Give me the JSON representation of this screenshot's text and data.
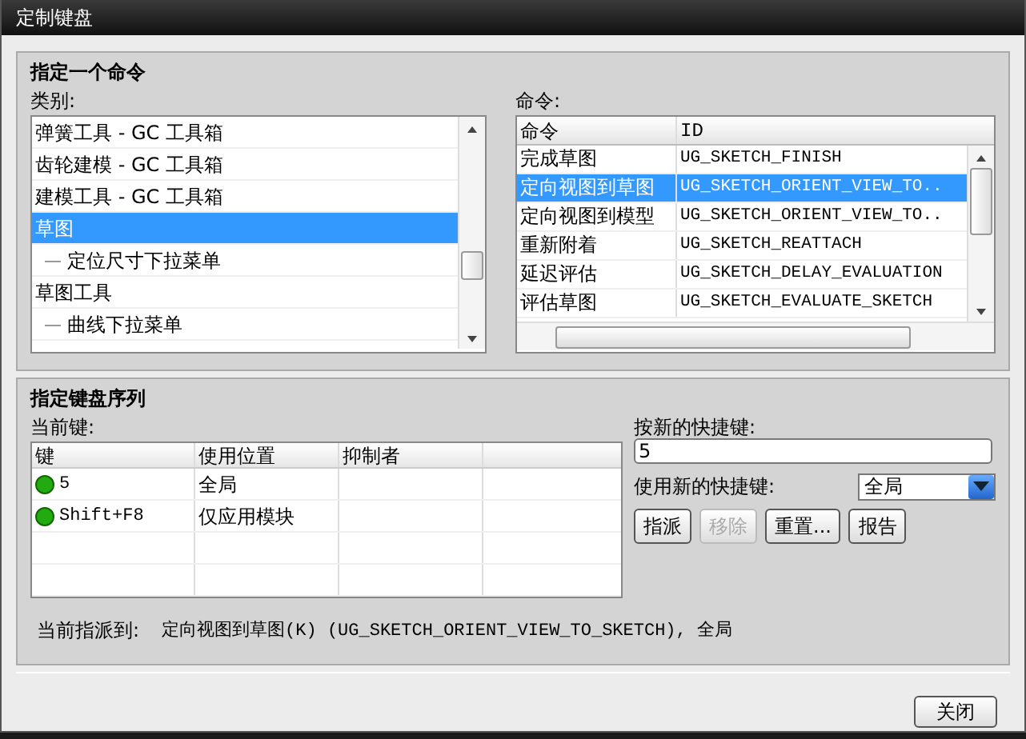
{
  "window": {
    "title": "定制键盘"
  },
  "command_section": {
    "title": "指定一个命令",
    "category_label": "类别:",
    "categories": [
      {
        "label": "弹簧工具 - GC 工具箱",
        "selected": false
      },
      {
        "label": "齿轮建模 - GC 工具箱",
        "selected": false
      },
      {
        "label": "建模工具 - GC 工具箱",
        "selected": false
      },
      {
        "label": "草图",
        "selected": true,
        "children": [
          {
            "label": "定位尺寸下拉菜单",
            "selected": false
          }
        ]
      },
      {
        "label": "草图工具",
        "selected": false,
        "children": [
          {
            "label": "曲线下拉菜单",
            "selected": false
          }
        ]
      }
    ],
    "command_label": "命令:",
    "command_columns": [
      "命令",
      "ID"
    ],
    "commands": [
      {
        "name": "完成草图",
        "id": "UG_SKETCH_FINISH",
        "selected": false
      },
      {
        "name": "定向视图到草图",
        "id": "UG_SKETCH_ORIENT_VIEW_TO..",
        "selected": true
      },
      {
        "name": "定向视图到模型",
        "id": "UG_SKETCH_ORIENT_VIEW_TO..",
        "selected": false
      },
      {
        "name": "重新附着",
        "id": "UG_SKETCH_REATTACH",
        "selected": false
      },
      {
        "name": "延迟评估",
        "id": "UG_SKETCH_DELAY_EVALUATION",
        "selected": false
      },
      {
        "name": "评估草图",
        "id": "UG_SKETCH_EVALUATE_SKETCH",
        "selected": false
      }
    ]
  },
  "key_section": {
    "title": "指定键盘序列",
    "current_label": "当前键:",
    "key_columns": [
      "键",
      "使用位置",
      "抑制者"
    ],
    "keys": [
      {
        "key": "5",
        "scope": "全局"
      },
      {
        "key": "Shift+F8",
        "scope": "仅应用模块"
      }
    ],
    "new_key_label": "按新的快捷键:",
    "new_key_value": "5",
    "use_label": "使用新的快捷键:",
    "use_value": "全局",
    "buttons": [
      {
        "label": "指派",
        "disabled": false
      },
      {
        "label": "移除",
        "disabled": true
      },
      {
        "label": "重置...",
        "disabled": false
      },
      {
        "label": "报告",
        "disabled": false
      }
    ],
    "assigned_label": "当前指派到:",
    "assigned_value": "定向视图到草图(K) (UG_SKETCH_ORIENT_VIEW_TO_SKETCH), 全局"
  },
  "footer": {
    "close_button": "关闭"
  }
}
